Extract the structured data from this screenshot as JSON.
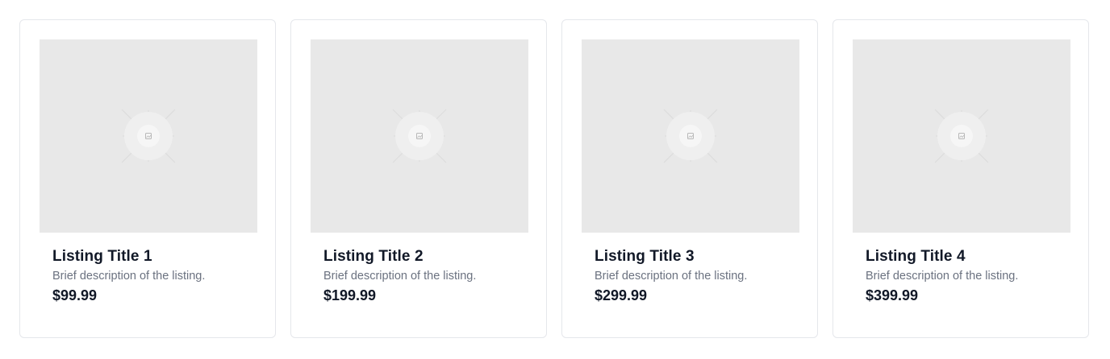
{
  "listings": [
    {
      "title": "Listing Title 1",
      "description": "Brief description of the listing.",
      "price": "$99.99",
      "image_icon": "image-placeholder-icon"
    },
    {
      "title": "Listing Title 2",
      "description": "Brief description of the listing.",
      "price": "$199.99",
      "image_icon": "image-placeholder-icon"
    },
    {
      "title": "Listing Title 3",
      "description": "Brief description of the listing.",
      "price": "$299.99",
      "image_icon": "image-placeholder-icon"
    },
    {
      "title": "Listing Title 4",
      "description": "Brief description of the listing.",
      "price": "$399.99",
      "image_icon": "image-placeholder-icon"
    }
  ],
  "colors": {
    "card_border": "#e5e7eb",
    "image_bg": "#e8e8e8",
    "title_text": "#111827",
    "description_text": "#6b7280"
  }
}
